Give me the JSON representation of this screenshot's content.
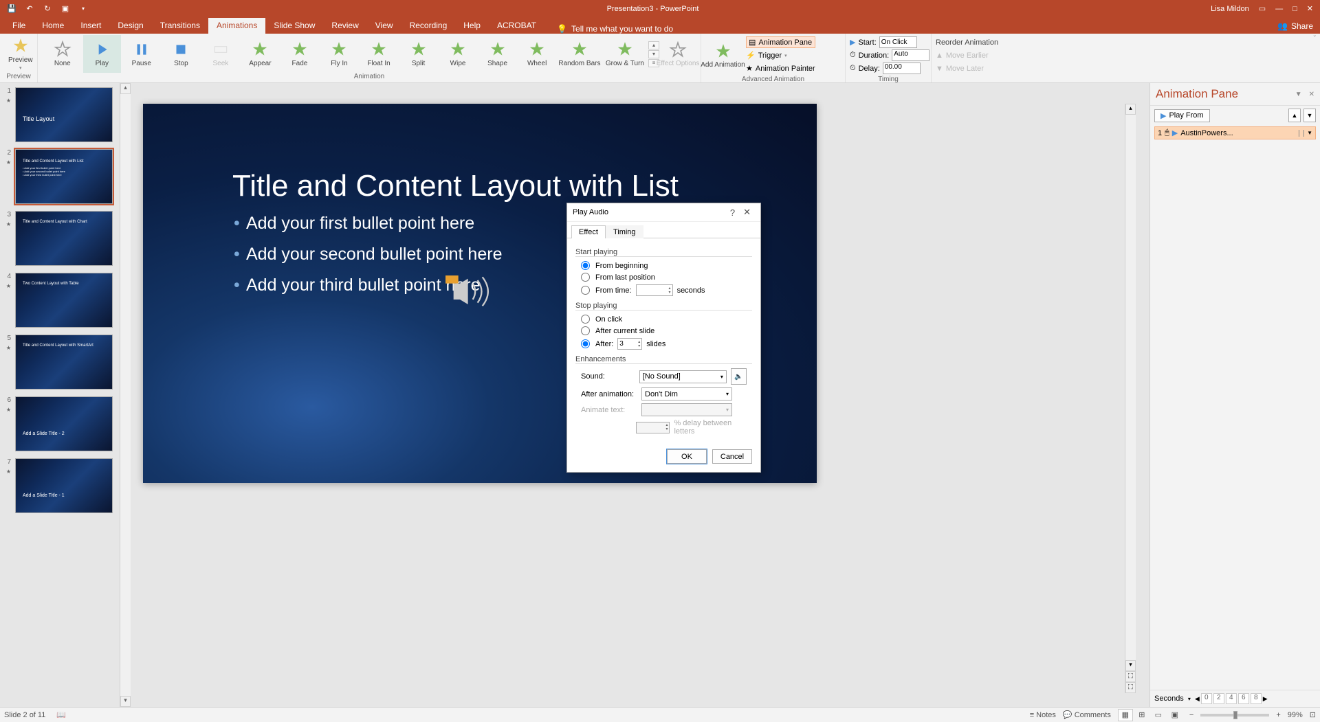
{
  "app": {
    "title": "Presentation3 - PowerPoint",
    "user": "Lisa Mildon"
  },
  "tabs": [
    "File",
    "Home",
    "Insert",
    "Design",
    "Transitions",
    "Animations",
    "Slide Show",
    "Review",
    "View",
    "Recording",
    "Help",
    "ACROBAT"
  ],
  "tellMe": "Tell me what you want to do",
  "share": "Share",
  "ribbon": {
    "preview": {
      "label": "Preview",
      "group": "Preview"
    },
    "animGallery": [
      "None",
      "Play",
      "Pause",
      "Stop",
      "Seek",
      "Appear",
      "Fade",
      "Fly In",
      "Float In",
      "Split",
      "Wipe",
      "Shape",
      "Wheel",
      "Random Bars",
      "Grow & Turn"
    ],
    "animationGroup": "Animation",
    "effectOptions": "Effect\nOptions",
    "addAnimation": "Add\nAnimation",
    "animationPane": "Animation Pane",
    "trigger": "Trigger",
    "animationPainter": "Animation Painter",
    "advancedGroup": "Advanced Animation",
    "timing": {
      "startLabel": "Start:",
      "startVal": "On Click",
      "durationLabel": "Duration:",
      "durationVal": "Auto",
      "delayLabel": "Delay:",
      "delayVal": "00.00",
      "reorder": "Reorder Animation",
      "moveEarlier": "Move Earlier",
      "moveLater": "Move Later",
      "group": "Timing"
    }
  },
  "slide": {
    "title": "Title and Content Layout with List",
    "b1": "Add your first bullet point here",
    "b2": "Add your second bullet point here",
    "b3": "Add your third bullet point here"
  },
  "thumbs": [
    {
      "n": "1",
      "title": "Title Layout"
    },
    {
      "n": "2",
      "title": "Title and Content Layout with List"
    },
    {
      "n": "3",
      "title": "Title and Content Layout with Chart"
    },
    {
      "n": "4",
      "title": "Two Content Layout with Table"
    },
    {
      "n": "5",
      "title": "Title and Content Layout with SmartArt"
    },
    {
      "n": "6",
      "title": "Add a Slide Title - 2"
    },
    {
      "n": "7",
      "title": "Add a Slide Title - 1"
    }
  ],
  "animPane": {
    "title": "Animation Pane",
    "playFrom": "Play From",
    "item": {
      "index": "1",
      "name": "AustinPowers..."
    },
    "seconds": "Seconds"
  },
  "dialog": {
    "title": "Play Audio",
    "tabEffect": "Effect",
    "tabTiming": "Timing",
    "startPlaying": "Start playing",
    "fromBeginning": "From beginning",
    "fromLast": "From last position",
    "fromTime": "From time:",
    "secondsLabel": "seconds",
    "stopPlaying": "Stop playing",
    "onClick": "On click",
    "afterCurrent": "After current slide",
    "after": "After:",
    "afterVal": "3",
    "slidesLabel": "slides",
    "enhancements": "Enhancements",
    "soundLabel": "Sound:",
    "soundVal": "[No Sound]",
    "afterAnimLabel": "After animation:",
    "afterAnimVal": "Don't Dim",
    "animateTextLabel": "Animate text:",
    "delayBetween": "% delay between letters",
    "ok": "OK",
    "cancel": "Cancel"
  },
  "status": {
    "slideInfo": "Slide 2 of 11",
    "notes": "Notes",
    "comments": "Comments",
    "zoom": "99%",
    "timelineNums": [
      "0",
      "2",
      "4",
      "6",
      "8"
    ]
  }
}
